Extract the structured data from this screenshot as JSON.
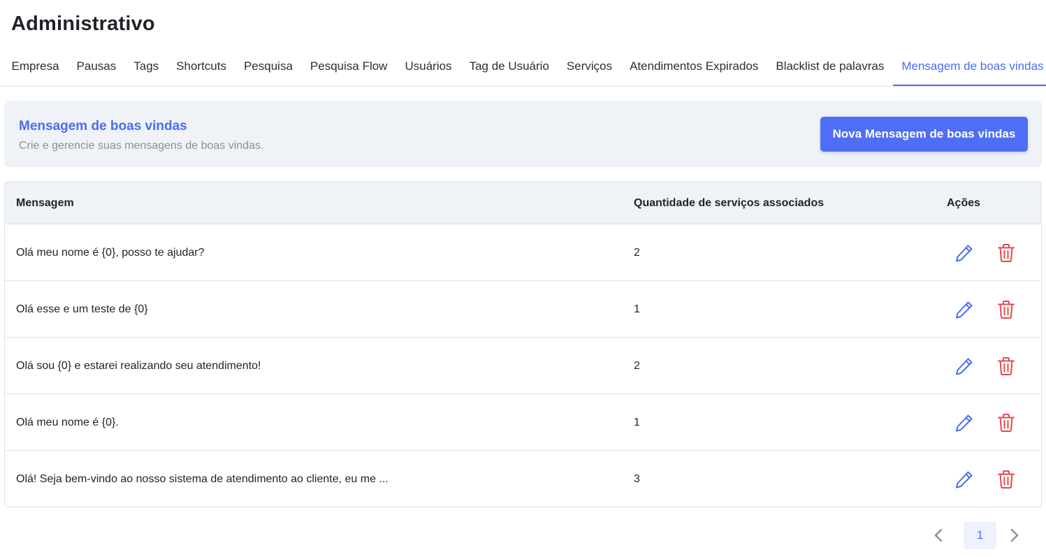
{
  "page": {
    "title": "Administrativo"
  },
  "tabs": [
    {
      "label": "Empresa"
    },
    {
      "label": "Pausas"
    },
    {
      "label": "Tags"
    },
    {
      "label": "Shortcuts"
    },
    {
      "label": "Pesquisa"
    },
    {
      "label": "Pesquisa Flow"
    },
    {
      "label": "Usuários"
    },
    {
      "label": "Tag de Usuário"
    },
    {
      "label": "Serviços"
    },
    {
      "label": "Atendimentos Expirados"
    },
    {
      "label": "Blacklist de palavras"
    },
    {
      "label": "Mensagem de boas vindas",
      "active": true
    }
  ],
  "hero": {
    "title": "Mensagem de boas vindas",
    "subtitle": "Crie e gerencie suas mensagens de boas vindas.",
    "new_button_label": "Nova Mensagem de boas vindas"
  },
  "table": {
    "headers": {
      "message": "Mensagem",
      "services_count": "Quantidade de serviços associados",
      "actions": "Ações"
    },
    "rows": [
      {
        "message": "Olá meu nome é {0}, posso te ajudar?",
        "services_count": "2"
      },
      {
        "message": "Olá esse e um teste de {0}",
        "services_count": "1"
      },
      {
        "message": "Olá sou {0} e estarei realizando seu atendimento!",
        "services_count": "2"
      },
      {
        "message": "Olá meu nome é {0}.",
        "services_count": "1"
      },
      {
        "message": "Olá! Seja bem-vindo ao nosso sistema de atendimento ao cliente, eu me ...",
        "services_count": "3"
      }
    ]
  },
  "pagination": {
    "current_page": "1"
  },
  "colors": {
    "accent": "#4b6cf2",
    "button": "#4d6ef5",
    "danger": "#e5484d",
    "header_bg": "#eff2f7"
  },
  "icons": {
    "edit": "pencil-icon",
    "delete": "trash-icon",
    "prev": "chevron-left-icon",
    "next": "chevron-right-icon"
  }
}
